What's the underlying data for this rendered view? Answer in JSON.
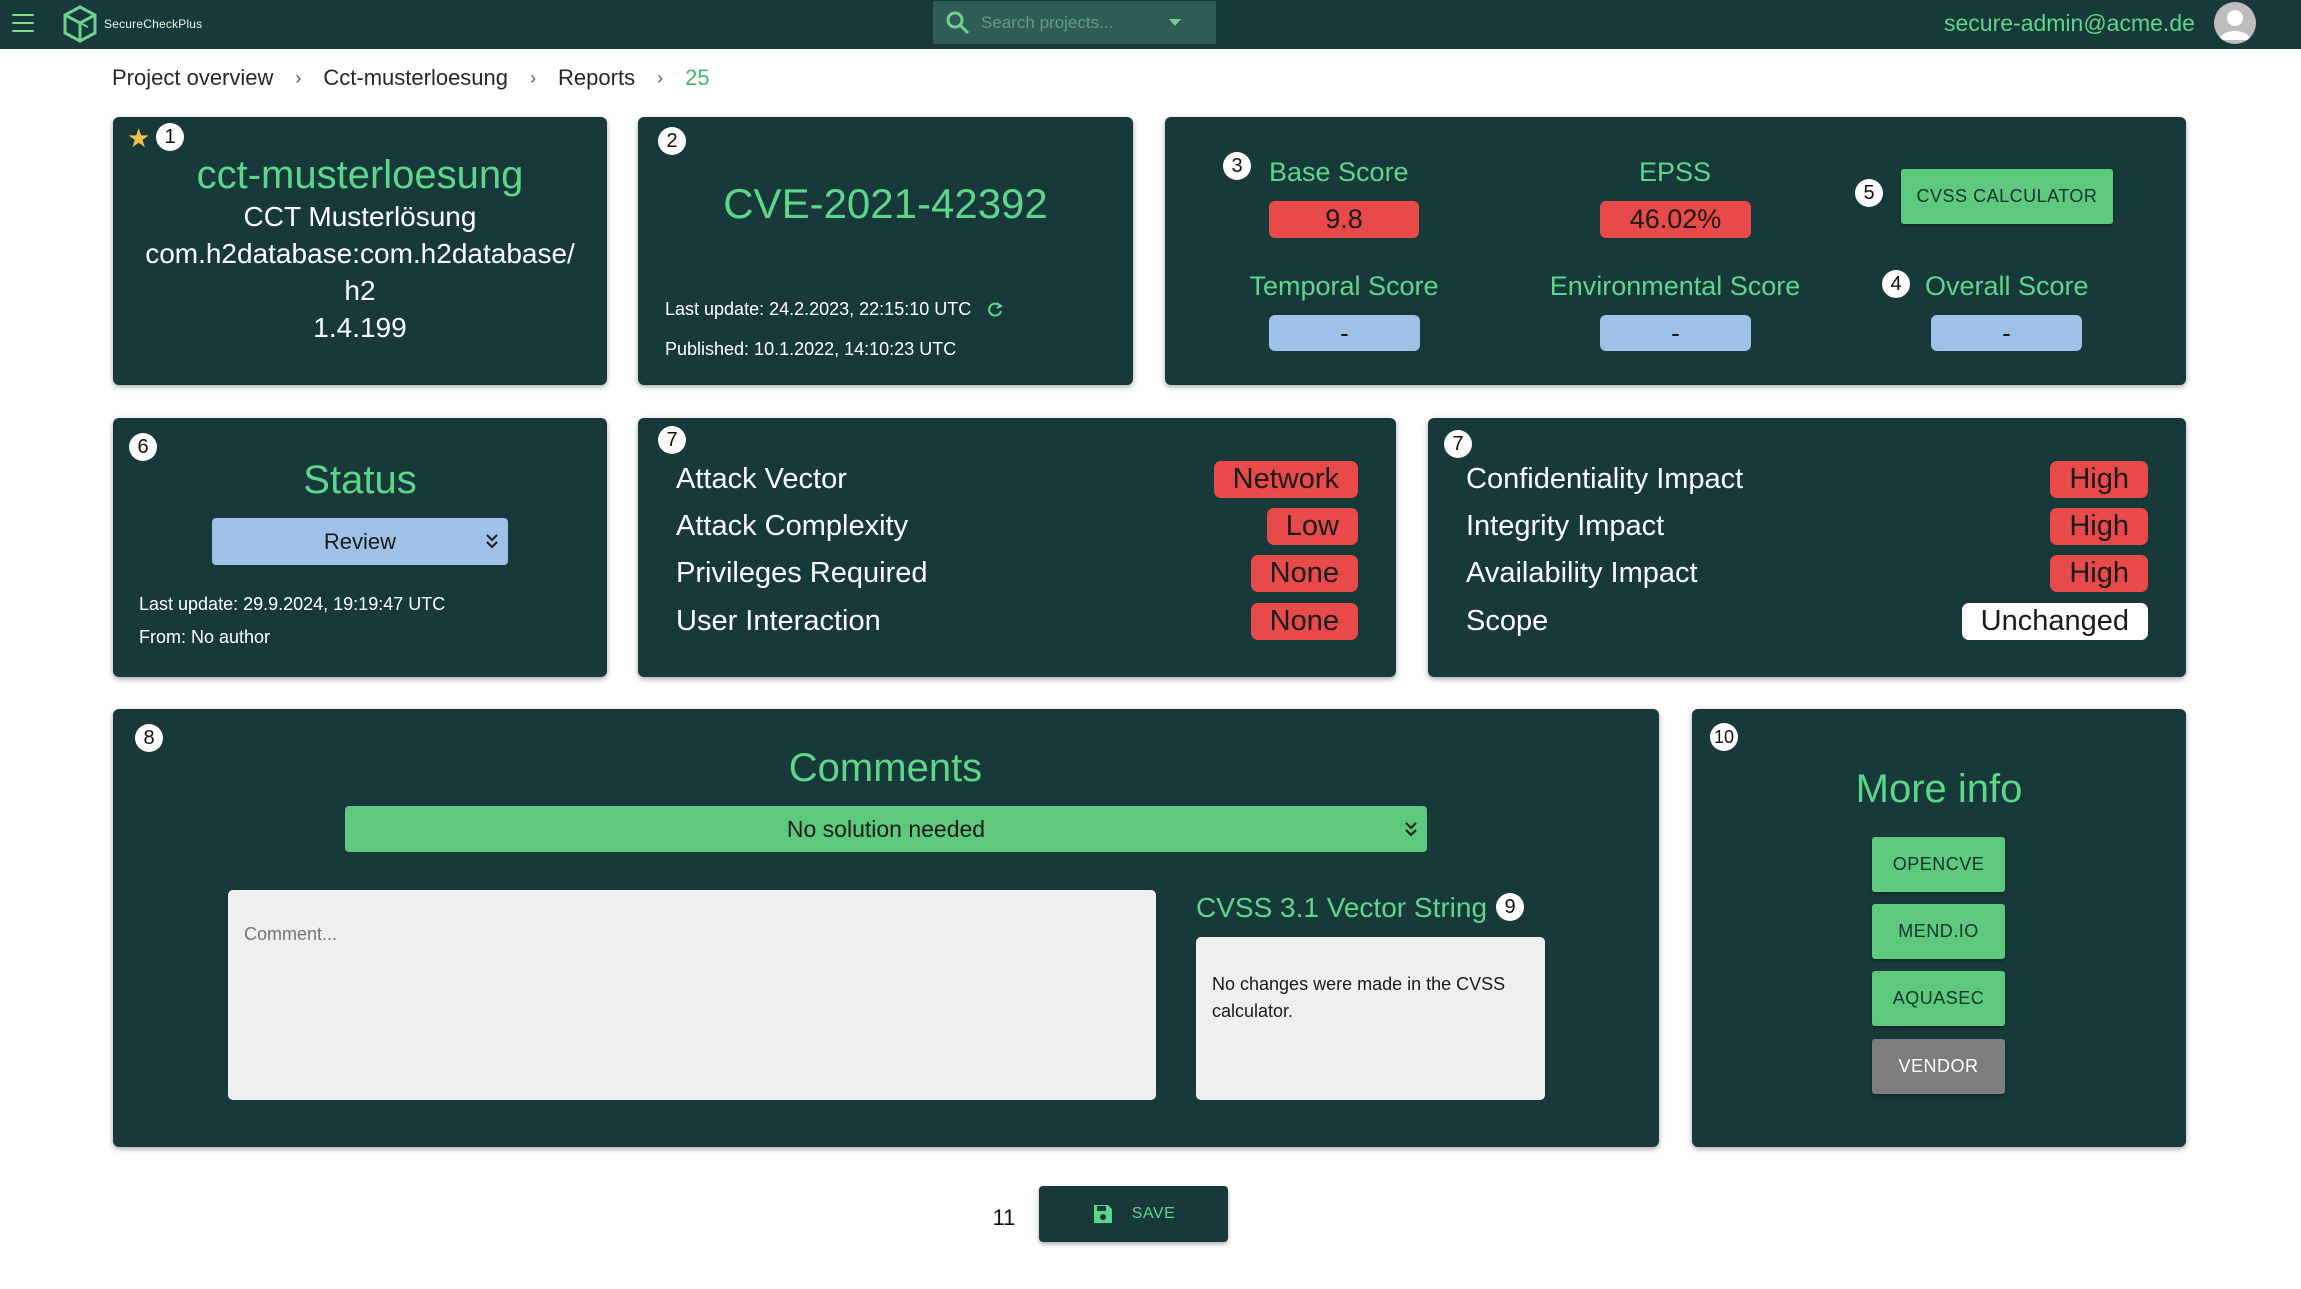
{
  "header": {
    "app_name": "SecureCheckPlus",
    "search_placeholder": "Search projects...",
    "user_email": "secure-admin@acme.de"
  },
  "breadcrumb": {
    "items": [
      "Project overview",
      "Cct-musterloesung",
      "Reports",
      "25"
    ]
  },
  "project_card": {
    "number": "1",
    "name": "cct-musterloesung",
    "display_name": "CCT Musterlösung",
    "package_line1": "com.h2database:com.h2database/",
    "package_line2": "h2",
    "version": "1.4.199"
  },
  "cve_card": {
    "number": "2",
    "cve_id": "CVE-2021-42392",
    "last_update": "Last update: 24.2.2023, 22:15:10 UTC",
    "published": "Published: 10.1.2022, 14:10:23 UTC"
  },
  "scores_card": {
    "base_number": "3",
    "base_label": "Base Score",
    "base_value": "9.8",
    "epss_label": "EPSS",
    "epss_value": "46.02%",
    "calc_number": "5",
    "calc_button": "CVSS CALCULATOR",
    "temporal_label": "Temporal Score",
    "temporal_value": "-",
    "environmental_label": "Environmental Score",
    "environmental_value": "-",
    "overall_number": "4",
    "overall_label": "Overall Score",
    "overall_value": "-"
  },
  "status_card": {
    "number": "6",
    "title": "Status",
    "selected": "Review",
    "last_update": "Last update: 29.9.2024, 19:19:47 UTC",
    "author": "From: No author"
  },
  "exploitability_card": {
    "number": "7",
    "rows": [
      {
        "label": "Attack Vector",
        "value": "Network"
      },
      {
        "label": "Attack Complexity",
        "value": "Low"
      },
      {
        "label": "Privileges Required",
        "value": "None"
      },
      {
        "label": "User Interaction",
        "value": "None"
      }
    ]
  },
  "impact_card": {
    "number": "7",
    "rows": [
      {
        "label": "Confidentiality Impact",
        "value": "High"
      },
      {
        "label": "Integrity Impact",
        "value": "High"
      },
      {
        "label": "Availability Impact",
        "value": "High"
      },
      {
        "label": "Scope",
        "value": "Unchanged"
      }
    ]
  },
  "comments_card": {
    "number": "8",
    "title": "Comments",
    "solution_selected": "No solution needed",
    "comment_placeholder": "Comment...",
    "vector_title": "CVSS 3.1 Vector String",
    "vector_number": "9",
    "vector_text": "No changes were made in the CVSS calculator."
  },
  "more_info_card": {
    "number": "10",
    "title": "More info",
    "buttons": [
      "OPENCVE",
      "MEND.IO",
      "AQUASEC",
      "VENDOR"
    ]
  },
  "save": {
    "number": "11",
    "label": "SAVE"
  },
  "colors": {
    "card_bg": "#17393a",
    "accent_green": "#5ed68a",
    "danger_red": "#e84a4a",
    "neutral_blue": "#9ec1e8"
  }
}
